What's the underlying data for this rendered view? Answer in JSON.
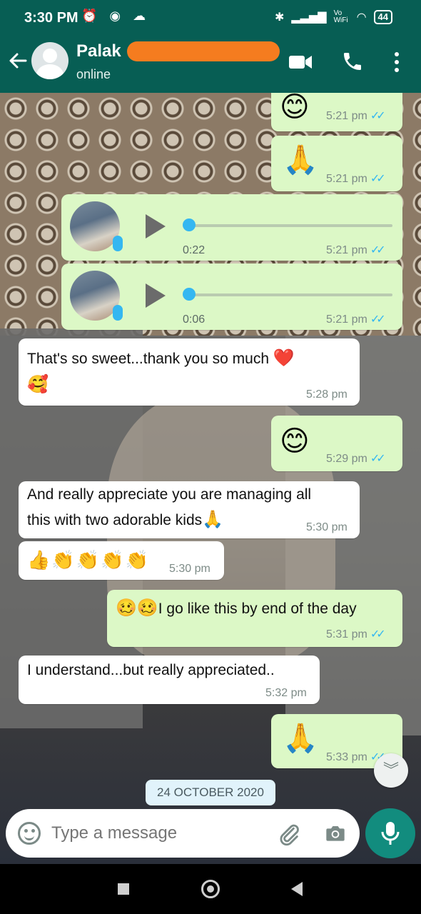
{
  "status_bar": {
    "time": "3:30 PM",
    "battery": "44",
    "wifi_label": "Vo WiFi"
  },
  "header": {
    "contact_name": "Palak",
    "contact_status": "online"
  },
  "messages": [
    {
      "emoji": "😊",
      "time": "5:21 pm"
    },
    {
      "emoji": "🙏",
      "time": "5:21 pm"
    },
    {
      "duration": "0:22",
      "time": "5:21 pm"
    },
    {
      "duration": "0:06",
      "time": "5:21 pm"
    },
    {
      "text": "That's so sweet...thank you so much",
      "emoji_inline": "❤️",
      "emoji_line2": "🥰",
      "time": "5:28 pm"
    },
    {
      "emoji": "😊",
      "time": "5:29 pm"
    },
    {
      "text_line1": "And really appreciate you are managing all",
      "text_line2": "this with two adorable kids",
      "emoji_inline": "🙏",
      "time": "5:30 pm"
    },
    {
      "emoji": "👍👏👏👏👏",
      "time": "5:30 pm"
    },
    {
      "emoji": "🥴🥴",
      "text": "I go like this by end of the day",
      "time": "5:31 pm"
    },
    {
      "text": "I understand...but really appreciated..",
      "time": "5:32 pm"
    },
    {
      "emoji": "🙏",
      "time": "5:33 pm"
    }
  ],
  "date_chip": "24 OCTOBER 2020",
  "input": {
    "placeholder": "Type a message"
  },
  "colors": {
    "header": "#075e54",
    "outgoing": "#dcf8c6",
    "incoming": "#ffffff",
    "accent": "#128c7e",
    "read_ticks": "#34b7f1"
  },
  "icons": [
    "back-arrow-icon",
    "video-call-icon",
    "phone-icon",
    "more-icon",
    "emoji-icon",
    "attach-icon",
    "camera-icon",
    "mic-icon"
  ]
}
